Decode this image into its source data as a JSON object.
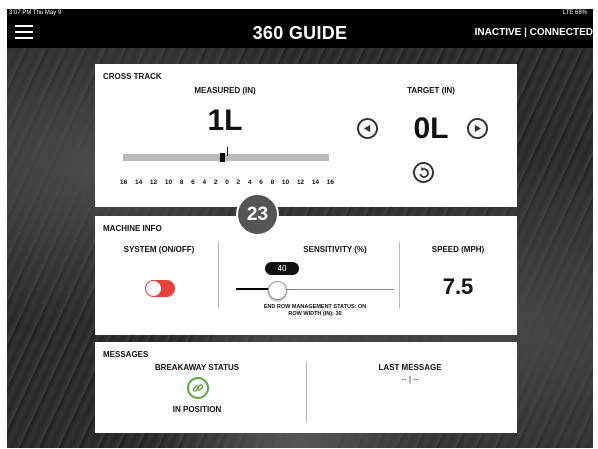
{
  "status_bar": {
    "time": "3:07 PM  Thu May 9",
    "signal": "LTE 68%"
  },
  "header": {
    "title": "360 GUIDE",
    "connection": "INACTIVE | CONNECTED"
  },
  "cross_track": {
    "section_label": "CROSS TRACK",
    "measured_label": "MEASURED (IN)",
    "measured_value": "1L",
    "target_label": "TARGET (IN)",
    "target_value": "0L",
    "scale_ticks": [
      "16",
      "14",
      "12",
      "10",
      "8",
      "6",
      "4",
      "2",
      "0",
      "2",
      "4",
      "6",
      "8",
      "10",
      "12",
      "14",
      "16"
    ]
  },
  "machine_info": {
    "section_label": "MACHINE INFO",
    "system_label": "SYSTEM (ON/OFF)",
    "system_on": false,
    "sensitivity_label": "SENSITIVITY (%)",
    "sensitivity_value": "40",
    "end_row_status": "END ROW MANAGEMENT STATUS: ON",
    "row_width": "ROW WIDTH (IN): 30",
    "speed_label": "SPEED (MPH)",
    "speed_value": "7.5"
  },
  "messages": {
    "section_label": "MESSAGES",
    "breakaway_label": "BREAKAWAY STATUS",
    "breakaway_value": "IN POSITION",
    "last_message_label": "LAST MESSAGE",
    "last_message_value": "-- | --"
  },
  "callout": {
    "number": "23"
  },
  "colors": {
    "toggle_off": "#e8413b",
    "link_icon": "#5fa340",
    "header_bg": "#000000"
  },
  "icons": [
    "hamburger-icon",
    "arrow-left-icon",
    "arrow-right-icon",
    "reset-icon",
    "link-icon"
  ]
}
